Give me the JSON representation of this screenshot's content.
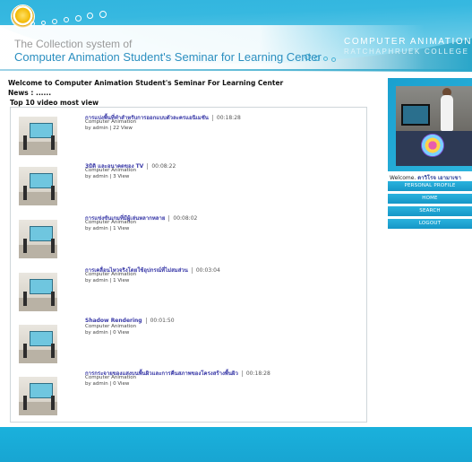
{
  "header": {
    "subtitle": "The Collection system of",
    "title": "Computer Animation Student's Seminar for Learning Center",
    "brand_line1": "COMPUTER ANIMATION",
    "brand_line2": "RATCHAPHRUEK COLLEGE"
  },
  "main": {
    "welcome": "Welcome to Computer Animation Student's Seminar For Learning Center",
    "news_label": "News : ......",
    "top_label": "Top 10 video most view",
    "videos": [
      {
        "title": "การแบ่งพื้นที่ทำสำหรับการออกแบบตัวละครแอนิเมชัน",
        "duration": "00:18:28",
        "category": "Computer Animation",
        "byline": "by admin",
        "views": "22 View"
      },
      {
        "title": "3มิติ และอนาคตของ TV",
        "duration": "00:08:22",
        "category": "Computer Animation",
        "byline": "by admin",
        "views": "3 View"
      },
      {
        "title": "การแข่งขันเกมที่มีผู้เล่นหลากหลาย",
        "duration": "00:08:02",
        "category": "Computer Animation",
        "byline": "by admin",
        "views": "1 View"
      },
      {
        "title": "การเคลื่อนไหวจริงโดยใช้อุปกรณ์ที่ไม่สมส่วน",
        "duration": "00:03:04",
        "category": "Computer Animation",
        "byline": "by admin",
        "views": "1 View"
      },
      {
        "title": "Shadow Rendering",
        "duration": "00:01:50",
        "category": "Computer Animation",
        "byline": "by admin",
        "views": "0 View"
      },
      {
        "title": "การกระจายของแสงบนพื้นผิวและการคืนสภาพของโครงสร้างพื้นผิว",
        "duration": "00:18:28",
        "category": "Computer Animation",
        "byline": "by admin",
        "views": "0 View"
      }
    ]
  },
  "sidebar": {
    "welcome_prefix": "Welcome.",
    "user_name": "ดาวิโรจ เอามาเขา",
    "menu": [
      "PERSONAL PROFILE",
      "HOME",
      "SEARCH",
      "LOGOUT"
    ]
  }
}
